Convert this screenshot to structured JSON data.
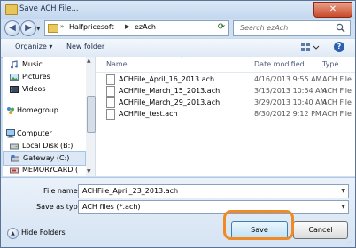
{
  "window": {
    "title": "Save ACH File..."
  },
  "address": {
    "segments": [
      "Halfpricesoft",
      "ezAch"
    ],
    "search_placeholder": "Search ezAch"
  },
  "toolbar": {
    "organize": "Organize",
    "organize_caret": "▾",
    "new_folder": "New folder"
  },
  "nav": [
    {
      "label": "Music",
      "icon": "music-icon"
    },
    {
      "label": "Pictures",
      "icon": "pictures-icon"
    },
    {
      "label": "Videos",
      "icon": "videos-icon"
    },
    {
      "label": "Homegroup",
      "icon": "homegroup-icon"
    },
    {
      "label": "Computer",
      "icon": "computer-icon"
    },
    {
      "label": "Local Disk (B:)",
      "icon": "drive-icon"
    },
    {
      "label": "Gateway (C:)",
      "icon": "drive-icon",
      "selected": true
    },
    {
      "label": "MEMORYCARD (",
      "icon": "card-icon"
    }
  ],
  "columns": {
    "name": "Name",
    "date": "Date modified",
    "type": "Type"
  },
  "files": [
    {
      "name": "ACHFile_April_16_2013.ach",
      "date": "4/16/2013 9:55 AM",
      "type": "ACH File"
    },
    {
      "name": "ACHFile_March_15_2013.ach",
      "date": "3/15/2013 10:54 AM",
      "type": "ACH File"
    },
    {
      "name": "ACHFile_March_29_2013.ach",
      "date": "3/29/2013 10:40 AM",
      "type": "ACH File"
    },
    {
      "name": "ACHFile_test.ach",
      "date": "8/30/2012 9:12 PM",
      "type": "ACH File"
    }
  ],
  "form": {
    "filename_label": "File name:",
    "filename_value": "ACHFile_April_23_2013.ach",
    "savetype_label": "Save as type:",
    "savetype_value": "ACH files (*.ach)"
  },
  "buttons": {
    "hide_folders": "Hide Folders",
    "save": "Save",
    "cancel": "Cancel"
  },
  "colors": {
    "highlight": "#f08a24"
  }
}
